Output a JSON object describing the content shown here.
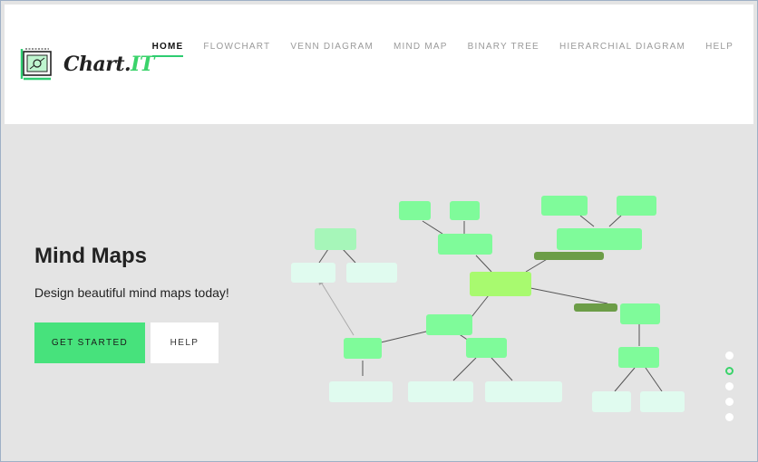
{
  "logo": {
    "text_main": "Chart.",
    "text_accent": "IT"
  },
  "nav": {
    "items": [
      {
        "label": "HOME",
        "active": true
      },
      {
        "label": "FLOWCHART",
        "active": false
      },
      {
        "label": "VENN DIAGRAM",
        "active": false
      },
      {
        "label": "MIND MAP",
        "active": false
      },
      {
        "label": "BINARY TREE",
        "active": false
      },
      {
        "label": "HIERARCHIAL DIAGRAM",
        "active": false
      },
      {
        "label": "HELP",
        "active": false
      }
    ]
  },
  "hero": {
    "title": "Mind Maps",
    "subtitle": "Design beautiful mind maps today!",
    "primary_button": "GET STARTED",
    "secondary_button": "HELP"
  },
  "carousel": {
    "slide_count": 5,
    "active_index": 1
  },
  "colors": {
    "accent": "#47e27c",
    "node_core": "#a8fa6f",
    "node_mid": "#7ffb9a",
    "node_light": "#e0fbef",
    "node_dark": "#6c9d47"
  }
}
